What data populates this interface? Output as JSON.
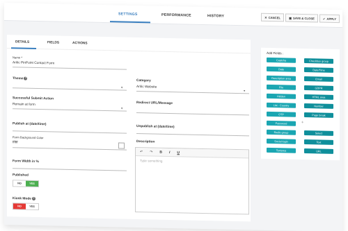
{
  "top_tabs": [
    "SETTINGS",
    "PERFORMANCE",
    "HISTORY"
  ],
  "top_actions": {
    "cancel": "CANCEL",
    "save_close": "SAVE & CLOSE",
    "apply": "APPLY"
  },
  "sub_tabs": [
    "DETAILS",
    "FIELDS",
    "ACTIONS"
  ],
  "form": {
    "name_label": "Name *",
    "name_value": "Aritic PinPoint Contact Form",
    "theme_label": "Theme",
    "category_label": "Category",
    "category_value": "Aritic Website",
    "submit_action_label": "Successful Submit Action",
    "submit_action_value": "Remain at form",
    "redirect_label": "Redirect URL/Message",
    "publish_label": "Publish at (date/time)",
    "unpublish_label": "Unpublish at (date/time)",
    "bgcolor_label": "Form Background Color",
    "bgcolor_value": "ffffff",
    "description_label": "Description",
    "description_placeholder": "Type something",
    "width_label": "Form Width in %",
    "published_label": "Published",
    "published_no": "NO",
    "published_yes": "YES",
    "kiosk_label": "Kiosk Mode",
    "kiosk_no": "NO",
    "kiosk_yes": "YES"
  },
  "fields_panel": {
    "title": "Add Fields :",
    "left": [
      "Captcha",
      "Date",
      "Description area",
      "File",
      "Hidden",
      "List - Country",
      "OTP",
      "Password",
      "Radio group",
      "Social login",
      "Textarea"
    ],
    "right": [
      "Checkbox group",
      "Date/Time",
      "Email",
      "GDPR",
      "HTML area",
      "Number",
      "Page break",
      "Select",
      "Text",
      "URL"
    ]
  },
  "colors": {
    "accent": "#3a7fbf",
    "chip": "#1aa6b2",
    "toggle_yes": "#4caf50",
    "toggle_no": "#e53935"
  }
}
